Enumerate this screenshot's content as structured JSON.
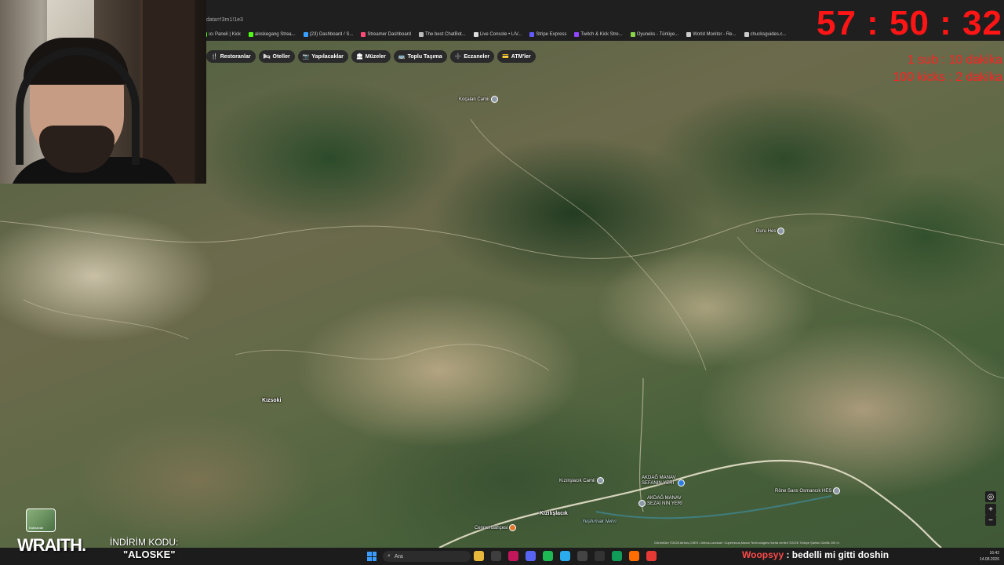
{
  "browser": {
    "url": "data=!3m1!1e3",
    "bookmarks": [
      {
        "label": "ıcı Paneli | Kick",
        "color": "#53fc18"
      },
      {
        "label": "aloskegang Strea...",
        "color": "#53fc18"
      },
      {
        "label": "(23) Dashboard / S...",
        "color": "#3aa0ff"
      },
      {
        "label": "Streamer Dashboard",
        "color": "#ff4a7a"
      },
      {
        "label": "The best ChatBot...",
        "color": "#bbbbbb"
      },
      {
        "label": "Live Console • LIV...",
        "color": "#dddddd"
      },
      {
        "label": "Stripe Express",
        "color": "#635bff"
      },
      {
        "label": "Twitch & Kick Stre...",
        "color": "#9146ff"
      },
      {
        "label": "Oyuneks - Türkiye...",
        "color": "#8ad34b"
      },
      {
        "label": "World Monitor - Re...",
        "color": "#cccccc"
      },
      {
        "label": "chucksguides.c...",
        "color": "#cccccc"
      }
    ]
  },
  "map_chips": [
    {
      "icon": "🍴",
      "label": "Restoranlar"
    },
    {
      "icon": "🛏",
      "label": "Oteller"
    },
    {
      "icon": "📷",
      "label": "Yapılacaklar"
    },
    {
      "icon": "🏛",
      "label": "Müzeler"
    },
    {
      "icon": "🚌",
      "label": "Toplu Taşıma"
    },
    {
      "icon": "➕",
      "label": "Eczaneler"
    },
    {
      "icon": "💳",
      "label": "ATM'ler"
    }
  ],
  "overlay": {
    "timer": "57 : 50 : 32",
    "sub_goal": "1 sub : 10 dakika",
    "kicks_goal": "100 kicks : 2 dakika"
  },
  "map_places": {
    "kocalan": "Koçalan Camii",
    "duru": "Duru Hes",
    "kizsoki": "Kızsoki",
    "kizilislacik_camii": "Kızılışlacık Camii",
    "akdag1_line1": "AKDAĞ MANAV",
    "akdag1_line2": "SEFANIN YERİ",
    "akdag2_line1": "AKDAĞ MANAV",
    "akdag2_line2": "SEZAİ NİN YERİ",
    "osmancik": "Röne Sans Osmancık HES",
    "kizilislacik": "Kızılışlacık",
    "cennet": "Cennet Bahçesi",
    "yesilirmak": "Yeşilırmak Nehri"
  },
  "map_attribution": "Görüntüler ©2026 Airbus,CNES / Airbus,Landsat / Copernicus,Maxar Technologies,Harita verileri ©2026   Türkiye   Şartlar   Gizlilik   200 m",
  "sponsor": {
    "brand": "WRAITH.",
    "discount_label": "İNDİRİM KODU:",
    "code": "\"ALOSKE\"",
    "thumb_label": "Katmanlar"
  },
  "taskbar": {
    "search_placeholder": "Ara",
    "clock": "16:42",
    "date": "14.08.2026",
    "app_colors": [
      "#e6b73a",
      "#3e3e3e",
      "#c2185b",
      "#5865f2",
      "#1db954",
      "#2aabee",
      "#444444",
      "#333333",
      "#0f9d58",
      "#ff6d00",
      "#e53935"
    ]
  },
  "chat": {
    "user": "Woopsyy",
    "message": ": bedelli mi gitti doshin"
  }
}
